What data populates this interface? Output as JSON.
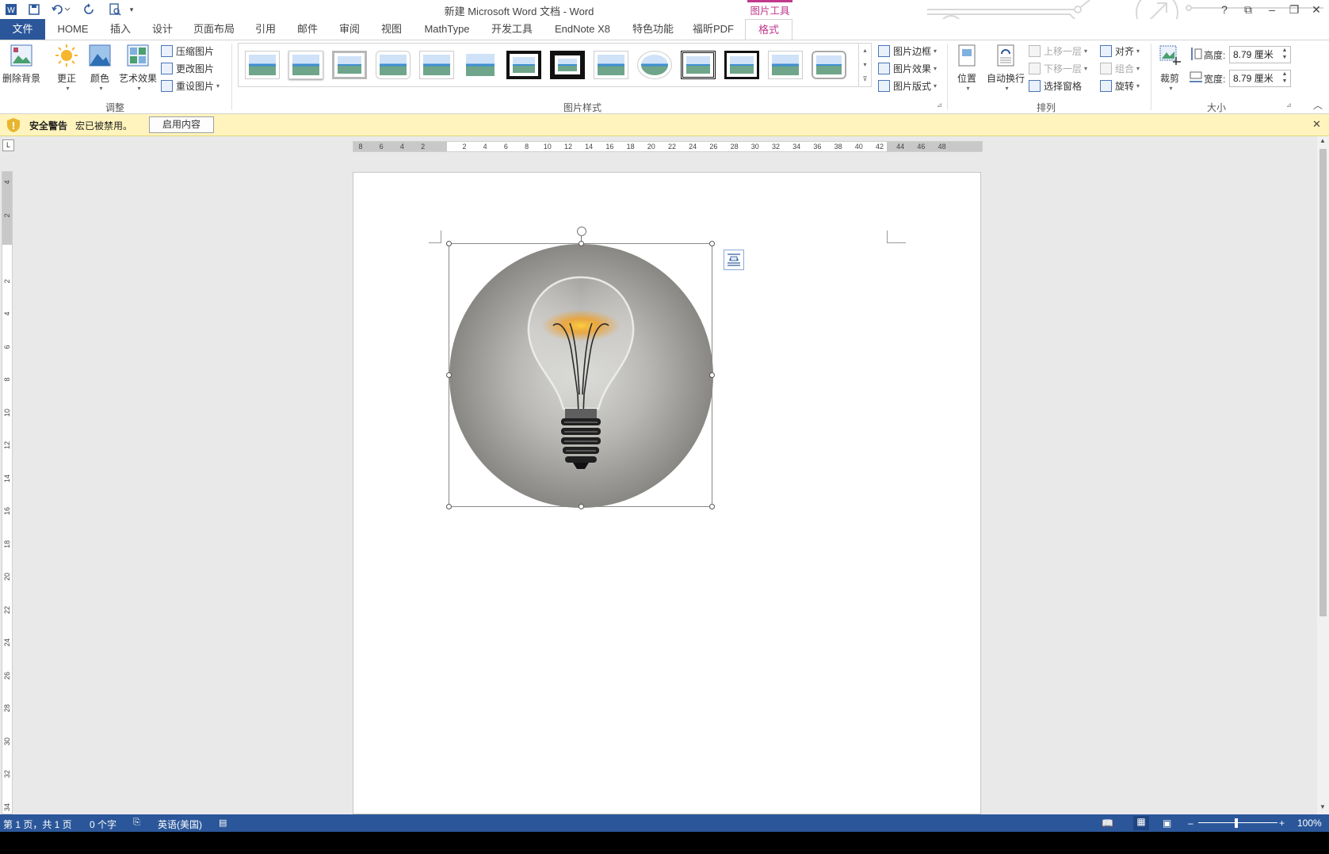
{
  "title_bar": {
    "document_title": "新建 Microsoft Word 文档 - Word",
    "context_tab_group": "图片工具",
    "window_buttons": [
      "?",
      "⧉",
      "–",
      "❐",
      "✕"
    ]
  },
  "tabs": [
    "文件",
    "HOME",
    "插入",
    "设计",
    "页面布局",
    "引用",
    "邮件",
    "审阅",
    "视图",
    "MathType",
    "开发工具",
    "EndNote X8",
    "特色功能",
    "福昕PDF",
    "格式"
  ],
  "ribbon": {
    "adjust": {
      "remove_bg": "删除背景",
      "corrections": "更正",
      "color": "颜色",
      "artistic": "艺术效果",
      "compress": "压缩图片",
      "change": "更改图片",
      "reset": "重设图片",
      "group_label": "调整"
    },
    "styles": {
      "border": "图片边框",
      "effects": "图片效果",
      "layout": "图片版式",
      "group_label": "图片样式"
    },
    "arrange": {
      "position": "位置",
      "wrap": "自动换行",
      "forward": "上移一层",
      "backward": "下移一层",
      "selection_pane": "选择窗格",
      "align": "对齐",
      "group": "组合",
      "rotate": "旋转",
      "group_label": "排列"
    },
    "size": {
      "crop": "裁剪",
      "height_label": "高度:",
      "height_value": "8.79 厘米",
      "width_label": "宽度:",
      "width_value": "8.79 厘米",
      "group_label": "大小"
    }
  },
  "security_bar": {
    "title": "安全警告",
    "message": "宏已被禁用。",
    "button": "启用内容"
  },
  "ruler": {
    "horizontal": [
      "8",
      "6",
      "4",
      "2",
      "",
      "2",
      "4",
      "6",
      "8",
      "10",
      "12",
      "14",
      "16",
      "18",
      "20",
      "22",
      "24",
      "26",
      "28",
      "30",
      "32",
      "34",
      "36",
      "38",
      "40",
      "42",
      "44",
      "46",
      "48"
    ],
    "vertical": [
      "4",
      "2",
      "",
      "2",
      "4",
      "6",
      "8",
      "10",
      "12",
      "14",
      "16",
      "18",
      "20",
      "22",
      "24",
      "26",
      "28",
      "30",
      "32",
      "34"
    ]
  },
  "status_bar": {
    "page": "第 1 页，共 1 页",
    "words": "0 个字",
    "language": "英语(美国)",
    "zoom": "100%"
  }
}
